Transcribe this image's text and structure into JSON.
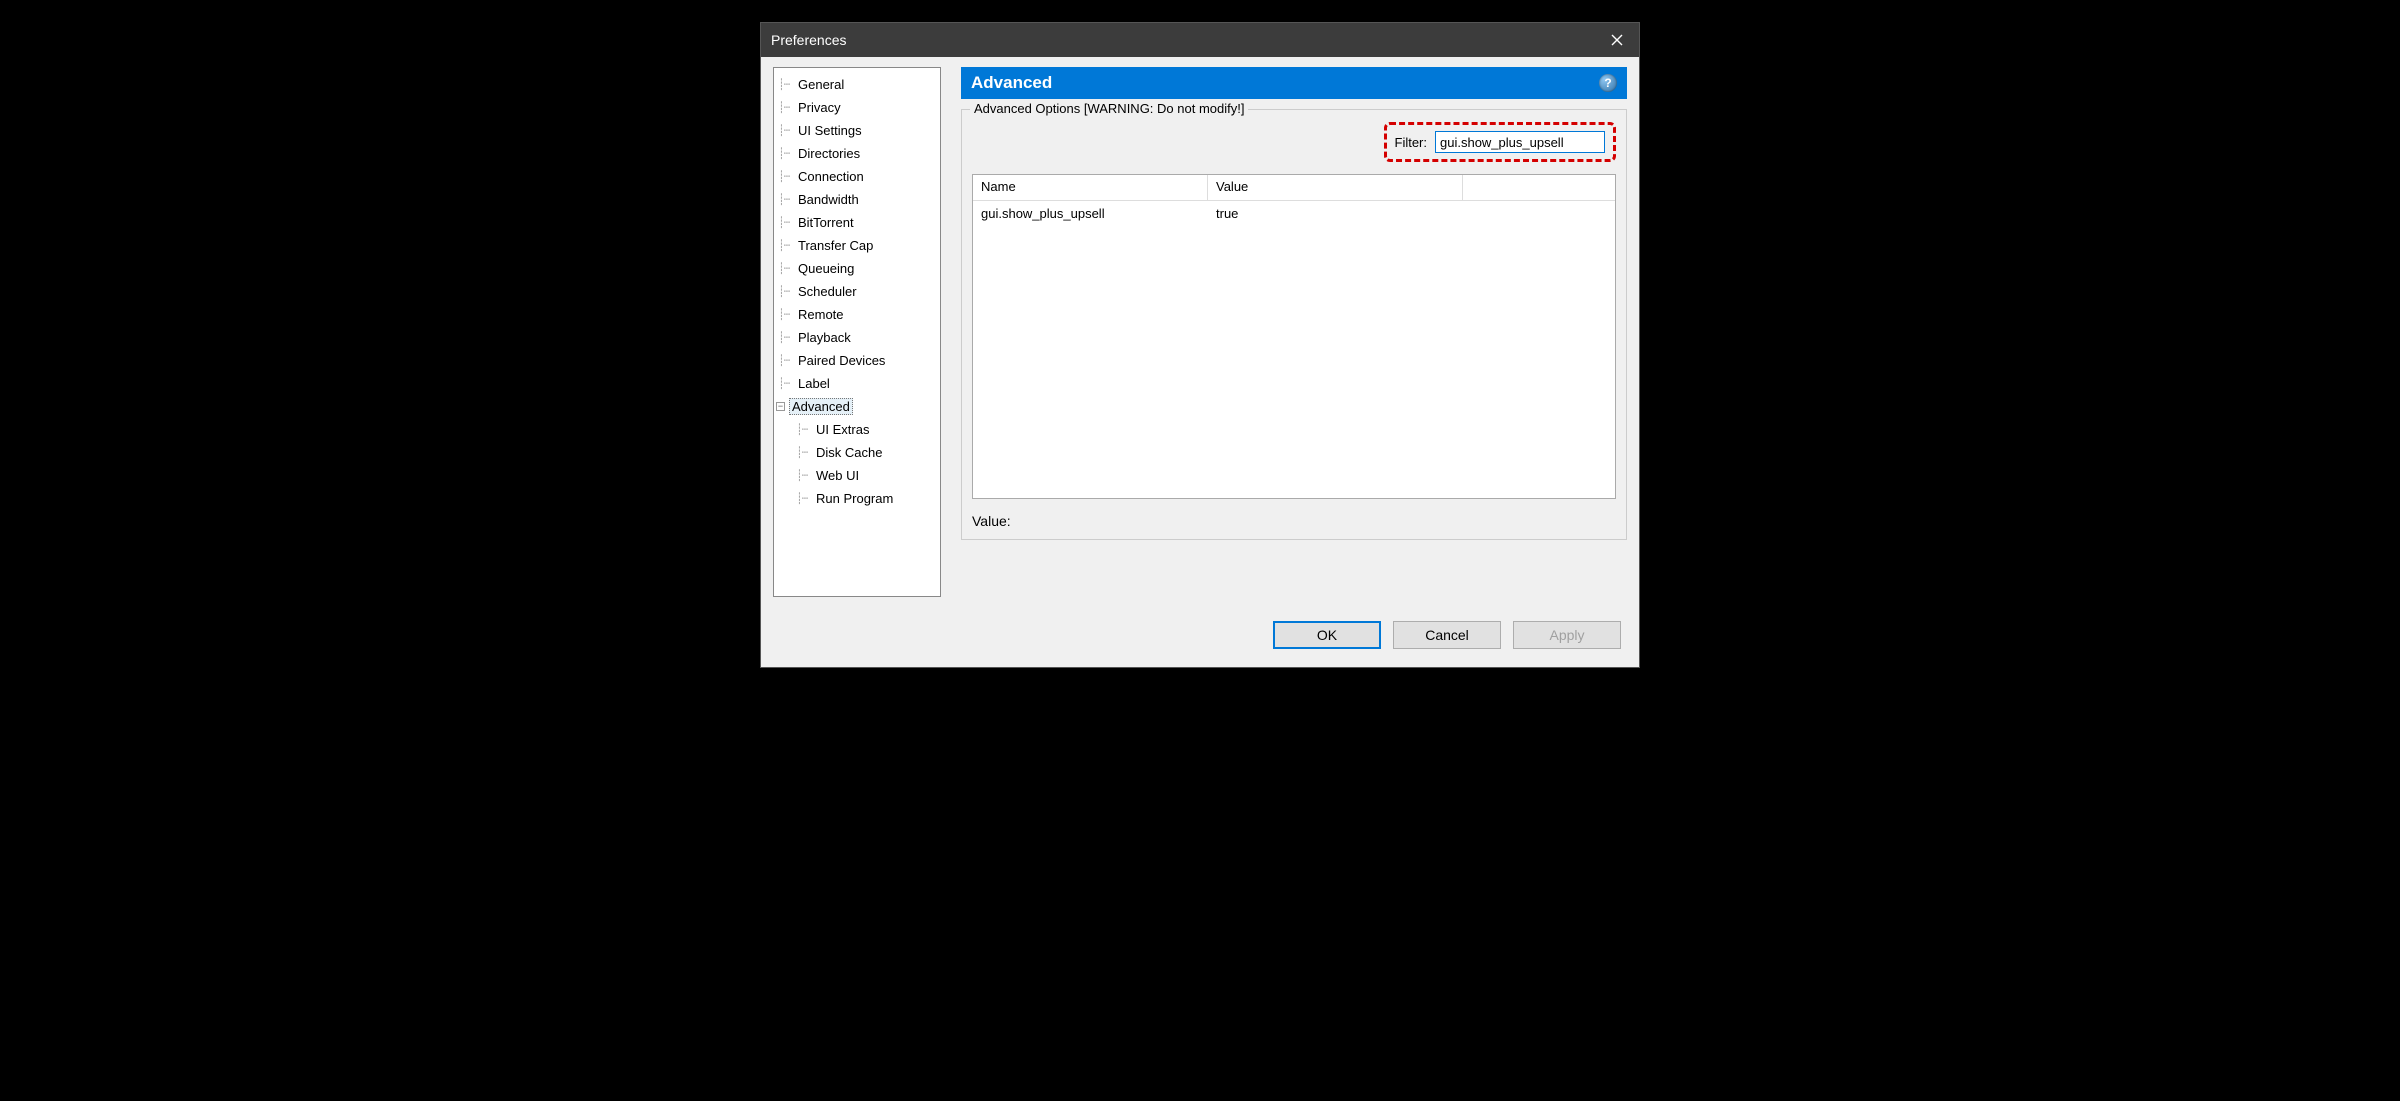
{
  "window": {
    "title": "Preferences"
  },
  "tree": {
    "items": [
      "General",
      "Privacy",
      "UI Settings",
      "Directories",
      "Connection",
      "Bandwidth",
      "BitTorrent",
      "Transfer Cap",
      "Queueing",
      "Scheduler",
      "Remote",
      "Playback",
      "Paired Devices",
      "Label"
    ],
    "advanced": {
      "label": "Advanced",
      "children": [
        "UI Extras",
        "Disk Cache",
        "Web UI",
        "Run Program"
      ]
    },
    "selected": "Advanced"
  },
  "panel": {
    "title": "Advanced",
    "groupbox_legend": "Advanced Options [WARNING: Do not modify!]",
    "filter_label": "Filter:",
    "filter_value": "gui.show_plus_upsell",
    "columns": {
      "name": "Name",
      "value": "Value"
    },
    "rows": [
      {
        "name": "gui.show_plus_upsell",
        "value": "true"
      }
    ],
    "value_label": "Value:"
  },
  "buttons": {
    "ok": "OK",
    "cancel": "Cancel",
    "apply": "Apply"
  }
}
